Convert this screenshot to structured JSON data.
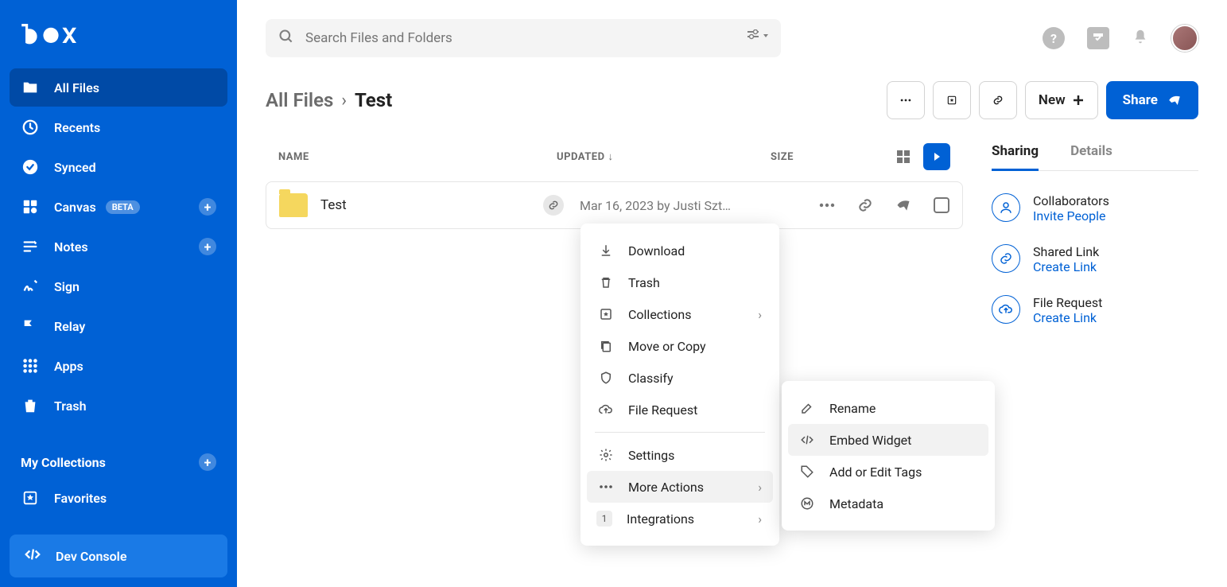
{
  "sidebar": {
    "items": [
      {
        "label": "All Files"
      },
      {
        "label": "Recents"
      },
      {
        "label": "Synced"
      },
      {
        "label": "Canvas",
        "badge": "BETA"
      },
      {
        "label": "Notes"
      },
      {
        "label": "Sign"
      },
      {
        "label": "Relay"
      },
      {
        "label": "Apps"
      },
      {
        "label": "Trash"
      }
    ],
    "collections_header": "My Collections",
    "favorites": "Favorites",
    "dev_console": "Dev Console"
  },
  "search": {
    "placeholder": "Search Files and Folders"
  },
  "breadcrumb": {
    "root": "All Files",
    "current": "Test"
  },
  "buttons": {
    "new": "New",
    "share": "Share"
  },
  "table": {
    "headers": {
      "name": "NAME",
      "updated": "UPDATED",
      "size": "SIZE"
    },
    "row": {
      "name": "Test",
      "updated": "Mar 16, 2023 by Justi Szt…"
    }
  },
  "details": {
    "tabs": {
      "sharing": "Sharing",
      "details": "Details"
    },
    "collaborators": {
      "title": "Collaborators",
      "link": "Invite People"
    },
    "shared_link": {
      "title": "Shared Link",
      "link": "Create Link"
    },
    "file_request": {
      "title": "File Request",
      "link": "Create Link"
    }
  },
  "menu": {
    "download": "Download",
    "trash": "Trash",
    "collections": "Collections",
    "move_copy": "Move or Copy",
    "classify": "Classify",
    "file_request": "File Request",
    "settings": "Settings",
    "more_actions": "More Actions",
    "integrations": "Integrations",
    "integrations_count": "1"
  },
  "submenu": {
    "rename": "Rename",
    "embed_widget": "Embed Widget",
    "add_tags": "Add or Edit Tags",
    "metadata": "Metadata"
  }
}
